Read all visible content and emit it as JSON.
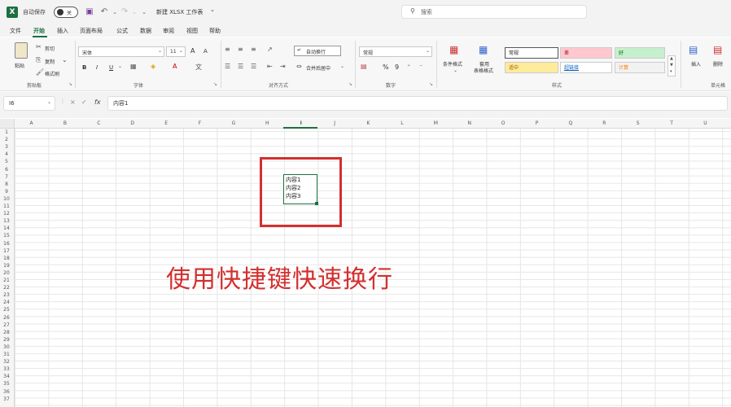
{
  "titlebar": {
    "autosave_label": "自动保存",
    "autosave_state": "关",
    "doc_title": "新建 XLSX 工作表",
    "doc_title_chevron": "⌄",
    "search_placeholder": "搜索"
  },
  "menu": {
    "tabs": [
      "文件",
      "开始",
      "插入",
      "页面布局",
      "公式",
      "数据",
      "审阅",
      "视图",
      "帮助"
    ],
    "active": "开始"
  },
  "ribbon": {
    "clipboard": {
      "paste": "粘贴",
      "cut": "剪切",
      "copy": "复制",
      "format_painter": "格式刷",
      "label": "剪贴板"
    },
    "font": {
      "font_name": "宋体",
      "font_size": "11",
      "bold": "B",
      "italic": "I",
      "underline": "U",
      "grow": "A",
      "shrink": "A",
      "label": "字体"
    },
    "alignment": {
      "wrap_text": "自动换行",
      "merge_center": "合并后居中",
      "label": "对齐方式"
    },
    "number": {
      "format": "常规",
      "percent": "%",
      "comma": "9",
      "label": "数字"
    },
    "styles": {
      "conditional": "条件格式",
      "table_format_1": "套用",
      "table_format_2": "表格格式",
      "cells": [
        {
          "text": "常规",
          "bg": "#ffffff",
          "color": "#222222"
        },
        {
          "text": "差",
          "bg": "#ffc7ce",
          "color": "#9c0006"
        },
        {
          "text": "好",
          "bg": "#c6efce",
          "color": "#006100"
        },
        {
          "text": "适中",
          "bg": "#ffeb9c",
          "color": "#9c5700"
        },
        {
          "text": "超链接",
          "bg": "#ffffff",
          "color": "#0563c1"
        },
        {
          "text": "计算",
          "bg": "#f2f2f2",
          "color": "#fa7d00"
        }
      ],
      "label": "样式"
    },
    "cells_group": {
      "insert": "插入",
      "delete": "删除",
      "label": "单元格"
    }
  },
  "formula_bar": {
    "name_box": "I6",
    "cancel": "×",
    "enter": "✓",
    "fx": "fx",
    "content": "内容1"
  },
  "columns": [
    "A",
    "B",
    "C",
    "D",
    "E",
    "F",
    "G",
    "H",
    "I",
    "J",
    "K",
    "L",
    "M",
    "N",
    "O",
    "P",
    "Q",
    "R",
    "S",
    "T",
    "U"
  ],
  "selected_column": "I",
  "rows": [
    "1",
    "2",
    "3",
    "4",
    "5",
    "6",
    "7",
    "8",
    "9",
    "10",
    "11",
    "12",
    "13",
    "14",
    "15",
    "16",
    "17",
    "18",
    "19",
    "20",
    "21",
    "22",
    "23",
    "24",
    "25",
    "26",
    "27",
    "28",
    "29",
    "30",
    "31",
    "32",
    "33",
    "34",
    "35",
    "36",
    "37"
  ],
  "active_cell": {
    "lines": [
      "内容1",
      "内容2",
      "内容3"
    ]
  },
  "caption": "使用快捷键快速换行",
  "colors": {
    "accent": "#1d6f42",
    "highlight": "#d32f2f"
  }
}
